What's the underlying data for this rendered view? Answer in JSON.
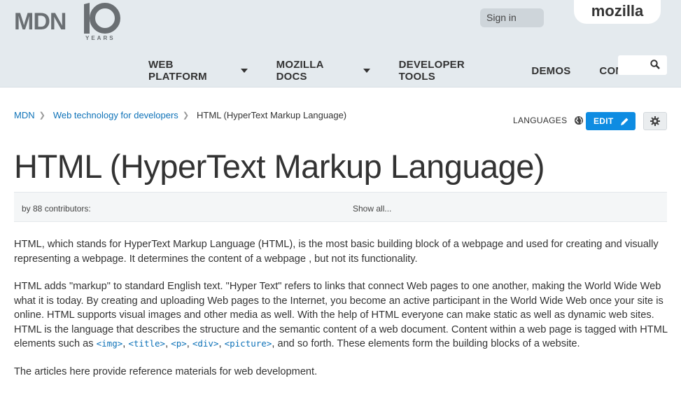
{
  "header": {
    "logo_text": "MDN",
    "logo_years": "YEARS",
    "signin_label": "Sign in",
    "mozilla_label": "mozilla",
    "nav": [
      {
        "label": "WEB PLATFORM",
        "has_caret": true
      },
      {
        "label": "MOZILLA DOCS",
        "has_caret": true
      },
      {
        "label": "DEVELOPER TOOLS",
        "has_caret": false
      },
      {
        "label": "DEMOS",
        "has_caret": false
      },
      {
        "label": "CONNECT",
        "has_caret": false
      }
    ],
    "search_placeholder": "",
    "search_icon": "search-icon"
  },
  "breadcrumb": {
    "items": [
      "MDN",
      "Web technology for developers"
    ],
    "current": "HTML (HyperText Markup Language)"
  },
  "toolbar": {
    "languages_label": "LANGUAGES",
    "edit_label": "EDIT"
  },
  "page": {
    "title": "HTML (HyperText Markup Language)",
    "contributors": "by 88 contributors:",
    "show_all": "Show all..."
  },
  "content": {
    "p1": "HTML, which stands for HyperText Markup Language (HTML), is the most basic building block of a webpage and used for creating and visually representing a webpage. It determines the content of a webpage , but not its functionality.",
    "p2_text": "HTML adds \"markup\" to standard English text. \"Hyper Text\" refers to links that connect Web pages to one another, making the World Wide Web what it is today. By creating and uploading Web pages to the Internet, you become an active participant in the World Wide Web once your site is online. HTML supports visual images and other media as well. With the help of HTML everyone can make static as well as dynamic web sites. HTML is the language that describes the structure and the semantic content of a web document. Content within a web page is tagged with HTML elements such as ",
    "codes": [
      "<img>",
      "<title>",
      "<p>",
      "<div>",
      "<picture>"
    ],
    "sep1": ", ",
    "sep2": ", ",
    "sep3": ", ",
    "sep4": ", ",
    "p2_end": ", and so forth. These elements form the building blocks of a website.",
    "p3": "The articles here provide reference materials for web development."
  },
  "colors": {
    "header_bg": "#e4eaee",
    "link": "#0e72b8",
    "edit_button": "#0e8ce2"
  }
}
